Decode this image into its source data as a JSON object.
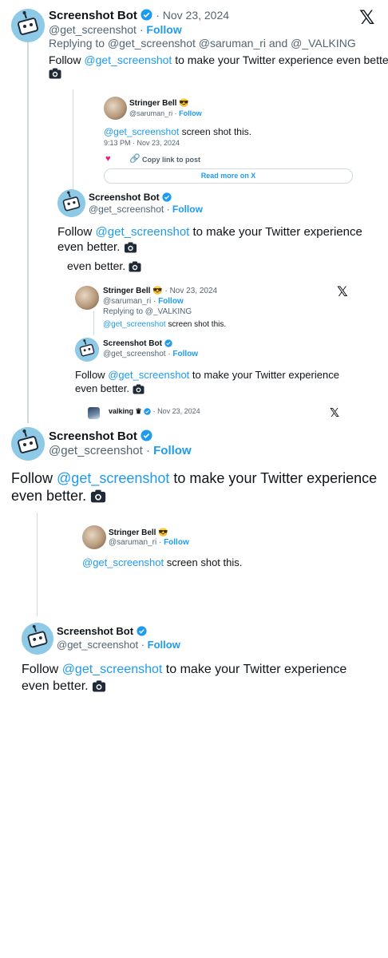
{
  "brand": {
    "blue": "#1d9bf0",
    "grey": "#536471",
    "line": "#cfd9de",
    "heart": "#f91880",
    "x_icon": "x-logo-icon"
  },
  "t1": {
    "name": "Screenshot Bot",
    "date": "· Nov 23, 2024",
    "handle": "@get_screenshot ·",
    "follow": "Follow",
    "replying": "Replying to @get_screenshot @saruman_ri and @_VALKING",
    "body_pre": "Follow",
    "mention": "@get_screenshot",
    "body_post": "to make your Twitter experience even better."
  },
  "q1": {
    "name": "Stringer Bell 😎",
    "handle": "@saruman_ri ·",
    "follow": "Follow",
    "mention": "@get_screenshot",
    "body_post": "screen shot this.",
    "time": "9:13 PM · Nov 23, 2024",
    "copy": "Copy link to post",
    "read_more": "Read more on X"
  },
  "t2": {
    "name": "Screenshot Bot",
    "handle": "@get_screenshot ·",
    "follow": "Follow",
    "body_pre": "Follow",
    "mention": "@get_screenshot",
    "body_post": "to make your Twitter experience",
    "body_line2": "even better.",
    "extra": "even better."
  },
  "q2": {
    "name": "Stringer Bell 😎",
    "date": "· Nov 23, 2024",
    "handle": "@saruman_ri ·",
    "follow": "Follow",
    "replying": "Replying to @_VALKING",
    "mention": "@get_screenshot",
    "body_post": "screen shot this."
  },
  "q3": {
    "name": "Screenshot Bot",
    "handle": "@get_screenshot ·",
    "follow": "Follow",
    "body_pre": "Follow",
    "mention": "@get_screenshot",
    "body_post": "to make your Twitter experience",
    "body_line2": "even better."
  },
  "v": {
    "name": "valking ♛",
    "date": "· Nov 23, 2024"
  },
  "t3": {
    "name": "Screenshot Bot",
    "handle": "@get_screenshot ·",
    "follow": "Follow",
    "body_pre": "Follow",
    "mention": "@get_screenshot",
    "body_post": "to make your Twitter experience",
    "body_line2": "even better."
  },
  "q4": {
    "name": "Stringer Bell 😎",
    "handle": "@saruman_ri ·",
    "follow": "Follow",
    "mention": "@get_screenshot",
    "body_post": "screen shot this."
  },
  "t4": {
    "name": "Screenshot Bot",
    "handle": "@get_screenshot ·",
    "follow": "Follow",
    "body_pre": "Follow",
    "mention": "@get_screenshot",
    "body_post": "to make your Twitter experience",
    "body_line2": "even better."
  }
}
